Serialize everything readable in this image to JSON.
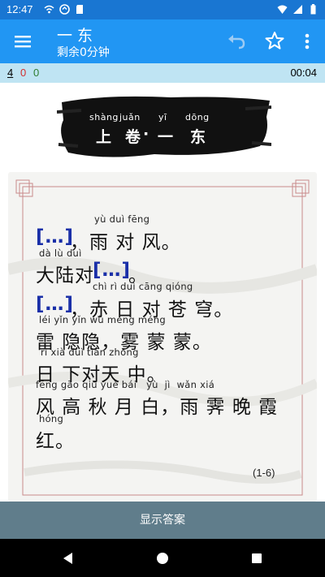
{
  "status": {
    "time": "12:47"
  },
  "appbar": {
    "title": "一 东",
    "subtitle": "剩余0分钟"
  },
  "scorebar": {
    "s1": "4",
    "s2": "0",
    "s3": "0",
    "timer": "00:04"
  },
  "header": {
    "pinyin": [
      "shàng",
      "juǎn",
      "yī",
      "dōng"
    ],
    "chars": [
      "上",
      "卷",
      "·",
      "一",
      "东"
    ]
  },
  "poem": {
    "lines": [
      {
        "pinyin": "yù duì fēng",
        "prefix": "[…]",
        "text": "，雨 对 风。"
      },
      {
        "pinyin": "dà lù duì",
        "text": "大陆对",
        "suffix": "[…]",
        "tail": "。"
      },
      {
        "pinyin": "chì rì duì cāng qióng",
        "prefix": "[…]",
        "text": "，赤 日 对 苍 穹。"
      },
      {
        "pinyin": "léi yǐn yǐn wù méng méng",
        "text": "雷 隐隐，雾 蒙 蒙。"
      },
      {
        "pinyin": "rì xià duì tiān zhōng",
        "text": "日 下对天  中。"
      },
      {
        "pinyin": "fēng gāo qiū yuè bái   yù  jì  wǎn xiá",
        "text": "风 高 秋 月 白，雨 霁 晚 霞"
      },
      {
        "pinyin": "hóng",
        "text": "红。"
      }
    ]
  },
  "counter": "(1-6)",
  "show_answer": "显示答案"
}
